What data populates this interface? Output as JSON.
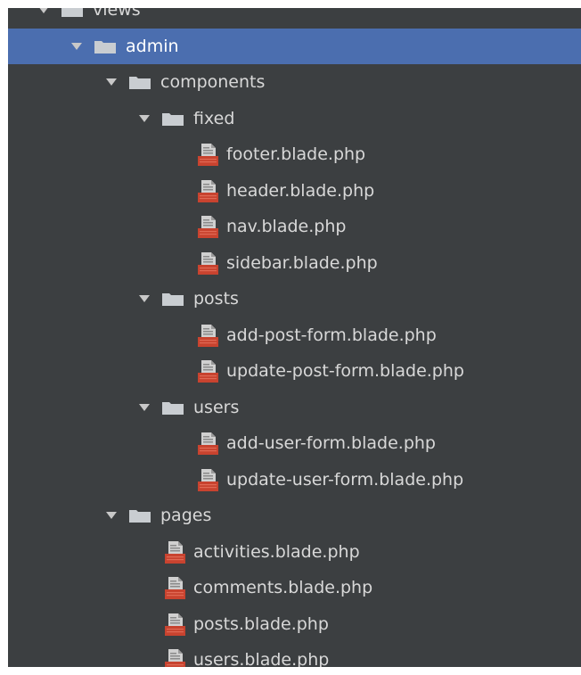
{
  "colors": {
    "panel_bg": "#3c3f41",
    "selected_bg": "#4b6eaf",
    "text": "#d8d8d8",
    "folder": "#c9cdd1",
    "file_doc": "#d0d0d0",
    "file_badge": "#c8432f"
  },
  "tree": [
    {
      "label": "views",
      "type": "folder",
      "depth": 0,
      "expanded": true,
      "icon": "folder-icon"
    },
    {
      "label": "admin",
      "type": "folder",
      "depth": 1,
      "expanded": true,
      "selected": true,
      "icon": "folder-icon"
    },
    {
      "label": "components",
      "type": "folder",
      "depth": 2,
      "expanded": true,
      "icon": "folder-icon"
    },
    {
      "label": "fixed",
      "type": "folder",
      "depth": 3,
      "expanded": true,
      "icon": "folder-icon"
    },
    {
      "label": "footer.blade.php",
      "type": "file",
      "depth": 4,
      "icon": "blade-file-icon"
    },
    {
      "label": "header.blade.php",
      "type": "file",
      "depth": 4,
      "icon": "blade-file-icon"
    },
    {
      "label": "nav.blade.php",
      "type": "file",
      "depth": 4,
      "icon": "blade-file-icon"
    },
    {
      "label": "sidebar.blade.php",
      "type": "file",
      "depth": 4,
      "icon": "blade-file-icon"
    },
    {
      "label": "posts",
      "type": "folder",
      "depth": 3,
      "expanded": true,
      "icon": "folder-icon"
    },
    {
      "label": "add-post-form.blade.php",
      "type": "file",
      "depth": 4,
      "icon": "blade-file-icon"
    },
    {
      "label": "update-post-form.blade.php",
      "type": "file",
      "depth": 4,
      "icon": "blade-file-icon"
    },
    {
      "label": "users",
      "type": "folder",
      "depth": 3,
      "expanded": true,
      "icon": "folder-icon"
    },
    {
      "label": "add-user-form.blade.php",
      "type": "file",
      "depth": 4,
      "icon": "blade-file-icon"
    },
    {
      "label": "update-user-form.blade.php",
      "type": "file",
      "depth": 4,
      "icon": "blade-file-icon"
    },
    {
      "label": "pages",
      "type": "folder",
      "depth": 2,
      "expanded": true,
      "icon": "folder-icon"
    },
    {
      "label": "activities.blade.php",
      "type": "file",
      "depth": 3,
      "icon": "blade-file-icon"
    },
    {
      "label": "comments.blade.php",
      "type": "file",
      "depth": 3,
      "icon": "blade-file-icon"
    },
    {
      "label": "posts.blade.php",
      "type": "file",
      "depth": 3,
      "icon": "blade-file-icon"
    },
    {
      "label": "users.blade.php",
      "type": "file",
      "depth": 3,
      "icon": "blade-file-icon"
    }
  ]
}
